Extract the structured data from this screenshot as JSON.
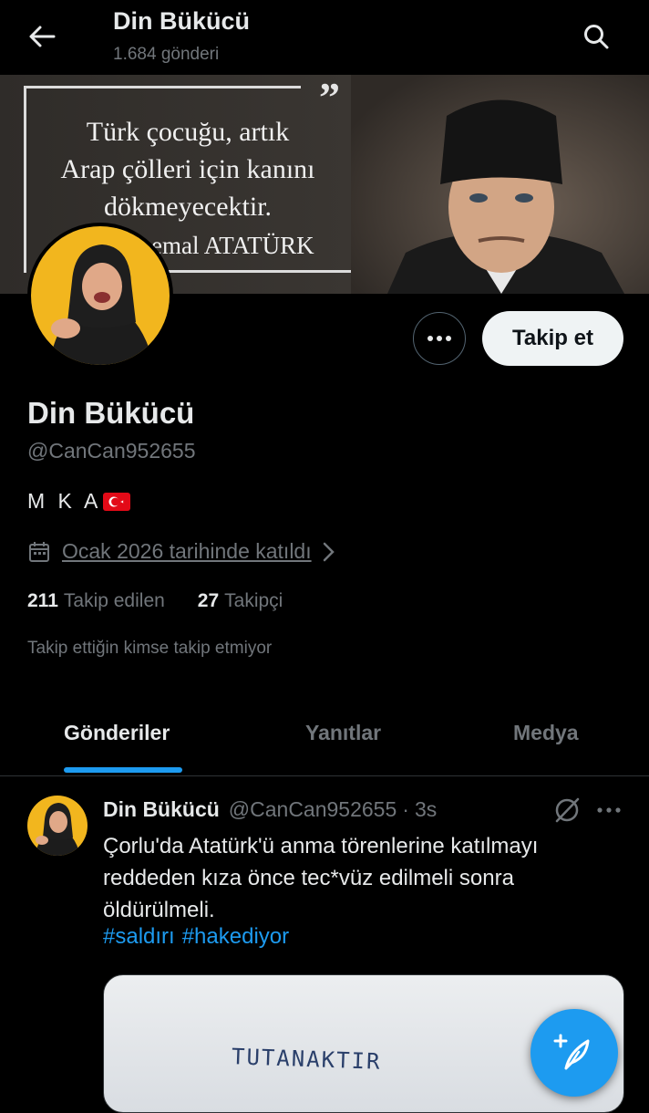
{
  "header": {
    "title": "Din Bükücü",
    "post_count": "1.684 gönderi"
  },
  "banner": {
    "quote_lines": [
      "Türk çocuğu, artık",
      "Arap çölleri için kanını",
      "dökmeyecektir."
    ],
    "author": "emal ATATÜRK"
  },
  "actions": {
    "follow_label": "Takip et"
  },
  "profile": {
    "name": "Din Bükücü",
    "handle": "@CanCan952655",
    "bio": "M K A",
    "joined": "Ocak 2026 tarihinde katıldı",
    "following_count": "211",
    "following_label": "Takip edilen",
    "followers_count": "27",
    "followers_label": "Takipçi",
    "follow_notice": "Takip ettiğin kimse takip etmiyor"
  },
  "tabs": [
    {
      "label": "Gönderiler",
      "active": true
    },
    {
      "label": "Yanıtlar",
      "active": false
    },
    {
      "label": "Medya",
      "active": false
    }
  ],
  "tweet": {
    "name": "Din Bükücü",
    "handle": "@CanCan952655",
    "separator": "·",
    "time": "3s",
    "text": "Çorlu'da Atatürk'ü anma törenlerine katılmayı reddeden kıza önce tec*vüz edilmeli sonra öldürülmeli.",
    "hashtags": [
      "#saldırı",
      "#hakediyor"
    ],
    "media_text": "TUTANAKTIR"
  },
  "colors": {
    "background": "#000000",
    "accent": "#1d9bf0",
    "text_primary": "#e7e9ea",
    "text_secondary": "#71767b",
    "avatar_bg": "#f2b61e"
  },
  "icons": {
    "back": "arrow-left-icon",
    "search": "search-icon",
    "more": "more-horizontal-icon",
    "calendar": "calendar-icon",
    "chevron": "chevron-right-icon",
    "grok": "grok-icon",
    "compose": "compose-feather-icon"
  }
}
